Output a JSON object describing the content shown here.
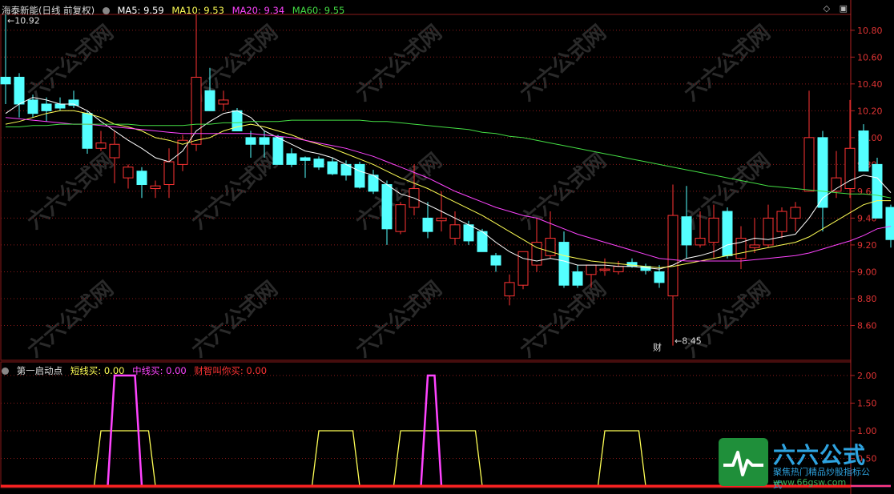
{
  "header": {
    "stock_title": "海泰新能(日线 前复权)",
    "ma5": "MA5: 9.59",
    "ma10": "MA10: 9.53",
    "ma20": "MA20: 9.34",
    "ma60": "MA60: 9.55",
    "colors": {
      "ma5": "#ffffff",
      "ma10": "#ffff55",
      "ma20": "#ff44ff",
      "ma60": "#44dd44"
    }
  },
  "indicator": {
    "title": "第一启动点",
    "short": "短线买: 0.00",
    "mid": "中线买: 0.00",
    "wisdom": "财智叫你买: 0.00",
    "colors": {
      "short": "#ffff55",
      "mid": "#ff44ff",
      "wisdom": "#ff3333"
    }
  },
  "annotations": {
    "high": "10.92",
    "low": "8.45",
    "marker": "财"
  },
  "watermark": "六六公式网",
  "logo": {
    "title": "六六公式",
    "subtitle": "聚焦热门精品炒股指标公式",
    "url": "www.66gsw.com"
  },
  "chart_data": [
    {
      "type": "candlestick",
      "title": "海泰新能(日线 前复权)",
      "y_ticks": [
        8.6,
        8.8,
        9.0,
        9.2,
        9.4,
        9.6,
        9.8,
        10.0,
        10.2,
        10.4,
        10.6,
        10.8
      ],
      "ylim": [
        8.4,
        10.93
      ],
      "up_color": "#ff3333",
      "down_color": "#54ffff",
      "candles": [
        {
          "o": 10.45,
          "h": 10.92,
          "l": 10.25,
          "c": 10.4
        },
        {
          "o": 10.45,
          "h": 10.48,
          "l": 10.15,
          "c": 10.25
        },
        {
          "o": 10.28,
          "h": 10.32,
          "l": 10.15,
          "c": 10.18
        },
        {
          "o": 10.25,
          "h": 10.3,
          "l": 10.12,
          "c": 10.2
        },
        {
          "o": 10.25,
          "h": 10.3,
          "l": 10.2,
          "c": 10.22
        },
        {
          "o": 10.28,
          "h": 10.35,
          "l": 10.22,
          "c": 10.24
        },
        {
          "o": 10.18,
          "h": 10.2,
          "l": 9.88,
          "c": 9.92
        },
        {
          "o": 9.92,
          "h": 10.05,
          "l": 9.9,
          "c": 9.96
        },
        {
          "o": 9.85,
          "h": 10.05,
          "l": 9.66,
          "c": 9.95
        },
        {
          "o": 9.7,
          "h": 9.8,
          "l": 9.62,
          "c": 9.78
        },
        {
          "o": 9.75,
          "h": 9.78,
          "l": 9.55,
          "c": 9.65
        },
        {
          "o": 9.62,
          "h": 9.68,
          "l": 9.55,
          "c": 9.64
        },
        {
          "o": 9.65,
          "h": 9.92,
          "l": 9.55,
          "c": 9.82
        },
        {
          "o": 9.8,
          "h": 10.02,
          "l": 9.75,
          "c": 9.98
        },
        {
          "o": 9.95,
          "h": 10.92,
          "l": 9.9,
          "c": 10.45
        },
        {
          "o": 10.35,
          "h": 10.52,
          "l": 10.2,
          "c": 10.2
        },
        {
          "o": 10.25,
          "h": 10.35,
          "l": 10.2,
          "c": 10.28
        },
        {
          "o": 10.2,
          "h": 10.22,
          "l": 10.08,
          "c": 10.05
        },
        {
          "o": 10.0,
          "h": 10.05,
          "l": 9.85,
          "c": 9.95
        },
        {
          "o": 10.0,
          "h": 10.05,
          "l": 9.85,
          "c": 9.95
        },
        {
          "o": 10.0,
          "h": 10.02,
          "l": 9.8,
          "c": 9.8
        },
        {
          "o": 9.88,
          "h": 9.92,
          "l": 9.78,
          "c": 9.8
        },
        {
          "o": 9.85,
          "h": 9.86,
          "l": 9.7,
          "c": 9.83
        },
        {
          "o": 9.84,
          "h": 9.86,
          "l": 9.76,
          "c": 9.78
        },
        {
          "o": 9.82,
          "h": 9.85,
          "l": 9.72,
          "c": 9.73
        },
        {
          "o": 9.8,
          "h": 9.83,
          "l": 9.68,
          "c": 9.72
        },
        {
          "o": 9.8,
          "h": 9.82,
          "l": 9.62,
          "c": 9.63
        },
        {
          "o": 9.72,
          "h": 9.76,
          "l": 9.58,
          "c": 9.6
        },
        {
          "o": 9.65,
          "h": 9.68,
          "l": 9.2,
          "c": 9.32
        },
        {
          "o": 9.3,
          "h": 9.52,
          "l": 9.28,
          "c": 9.5
        },
        {
          "o": 9.48,
          "h": 9.8,
          "l": 9.42,
          "c": 9.62
        },
        {
          "o": 9.4,
          "h": 9.52,
          "l": 9.25,
          "c": 9.3
        },
        {
          "o": 9.38,
          "h": 9.6,
          "l": 9.3,
          "c": 9.4
        },
        {
          "o": 9.25,
          "h": 9.45,
          "l": 9.2,
          "c": 9.35
        },
        {
          "o": 9.35,
          "h": 9.38,
          "l": 9.2,
          "c": 9.23
        },
        {
          "o": 9.3,
          "h": 9.32,
          "l": 9.15,
          "c": 9.15
        },
        {
          "o": 9.12,
          "h": 9.14,
          "l": 9.0,
          "c": 9.05
        },
        {
          "o": 8.82,
          "h": 8.98,
          "l": 8.75,
          "c": 8.92
        },
        {
          "o": 8.9,
          "h": 9.1,
          "l": 8.87,
          "c": 9.15
        },
        {
          "o": 9.05,
          "h": 9.4,
          "l": 9.0,
          "c": 9.22
        },
        {
          "o": 9.12,
          "h": 9.45,
          "l": 9.1,
          "c": 9.25
        },
        {
          "o": 9.22,
          "h": 9.3,
          "l": 8.88,
          "c": 8.9
        },
        {
          "o": 9.0,
          "h": 9.05,
          "l": 8.88,
          "c": 8.9
        },
        {
          "o": 8.98,
          "h": 9.05,
          "l": 8.88,
          "c": 9.05
        },
        {
          "o": 9.02,
          "h": 9.1,
          "l": 8.97,
          "c": 9.02
        },
        {
          "o": 9.0,
          "h": 9.08,
          "l": 8.98,
          "c": 9.04
        },
        {
          "o": 9.07,
          "h": 9.1,
          "l": 9.03,
          "c": 9.04
        },
        {
          "o": 9.04,
          "h": 9.06,
          "l": 8.98,
          "c": 9.01
        },
        {
          "o": 9.0,
          "h": 9.05,
          "l": 8.88,
          "c": 8.92
        },
        {
          "o": 8.82,
          "h": 9.65,
          "l": 8.45,
          "c": 9.42
        },
        {
          "o": 9.41,
          "h": 9.64,
          "l": 9.1,
          "c": 9.2
        },
        {
          "o": 9.2,
          "h": 9.45,
          "l": 9.18,
          "c": 9.25
        },
        {
          "o": 9.22,
          "h": 9.5,
          "l": 9.1,
          "c": 9.4
        },
        {
          "o": 9.45,
          "h": 9.48,
          "l": 9.1,
          "c": 9.12
        },
        {
          "o": 9.1,
          "h": 9.34,
          "l": 9.02,
          "c": 9.25
        },
        {
          "o": 9.18,
          "h": 9.4,
          "l": 9.14,
          "c": 9.2
        },
        {
          "o": 9.2,
          "h": 9.5,
          "l": 9.18,
          "c": 9.4
        },
        {
          "o": 9.3,
          "h": 9.48,
          "l": 9.25,
          "c": 9.45
        },
        {
          "o": 9.4,
          "h": 9.52,
          "l": 9.3,
          "c": 9.48
        },
        {
          "o": 9.6,
          "h": 10.35,
          "l": 9.6,
          "c": 10.0
        },
        {
          "o": 10.0,
          "h": 10.05,
          "l": 9.3,
          "c": 9.48
        },
        {
          "o": 9.6,
          "h": 9.9,
          "l": 9.55,
          "c": 9.7
        },
        {
          "o": 9.62,
          "h": 10.28,
          "l": 9.55,
          "c": 9.92
        },
        {
          "o": 10.05,
          "h": 10.1,
          "l": 9.75,
          "c": 9.75
        },
        {
          "o": 9.8,
          "h": 9.85,
          "l": 9.4,
          "c": 9.4
        },
        {
          "o": 9.48,
          "h": 9.5,
          "l": 9.18,
          "c": 9.24
        }
      ],
      "ma_series": [
        {
          "name": "MA5",
          "color": "#ffffff",
          "values": [
            10.18,
            10.25,
            10.3,
            10.28,
            10.25,
            10.25,
            10.2,
            10.12,
            10.05,
            9.98,
            9.92,
            9.85,
            9.82,
            9.9,
            10.05,
            10.12,
            10.18,
            10.2,
            10.15,
            10.05,
            10.0,
            9.95,
            9.9,
            9.88,
            9.85,
            9.8,
            9.75,
            9.72,
            9.65,
            9.58,
            9.55,
            9.5,
            9.45,
            9.4,
            9.35,
            9.3,
            9.22,
            9.15,
            9.1,
            9.08,
            9.1,
            9.08,
            9.05,
            9.05,
            9.05,
            9.04,
            9.04,
            9.03,
            9.02,
            9.05,
            9.1,
            9.12,
            9.15,
            9.2,
            9.22,
            9.25,
            9.24,
            9.26,
            9.28,
            9.4,
            9.55,
            9.62,
            9.68,
            9.72,
            9.7,
            9.59
          ]
        },
        {
          "name": "MA10",
          "color": "#ffff55",
          "values": [
            10.1,
            10.12,
            10.15,
            10.18,
            10.2,
            10.2,
            10.18,
            10.15,
            10.1,
            10.08,
            10.05,
            10.0,
            9.98,
            9.95,
            9.98,
            10.0,
            10.05,
            10.08,
            10.1,
            10.08,
            10.05,
            10.02,
            9.98,
            9.95,
            9.92,
            9.88,
            9.84,
            9.8,
            9.75,
            9.7,
            9.66,
            9.62,
            9.57,
            9.52,
            9.47,
            9.42,
            9.36,
            9.3,
            9.24,
            9.18,
            9.15,
            9.12,
            9.1,
            9.08,
            9.07,
            9.06,
            9.05,
            9.04,
            9.03,
            9.04,
            9.06,
            9.08,
            9.1,
            9.12,
            9.14,
            9.16,
            9.18,
            9.2,
            9.22,
            9.26,
            9.32,
            9.38,
            9.44,
            9.5,
            9.53,
            9.53
          ]
        },
        {
          "name": "MA20",
          "color": "#ff44ff",
          "values": [
            10.15,
            10.14,
            10.13,
            10.12,
            10.11,
            10.1,
            10.1,
            10.09,
            10.08,
            10.07,
            10.06,
            10.05,
            10.04,
            10.03,
            10.03,
            10.03,
            10.03,
            10.03,
            10.03,
            10.02,
            10.01,
            10.0,
            9.98,
            9.96,
            9.94,
            9.92,
            9.89,
            9.86,
            9.82,
            9.78,
            9.74,
            9.7,
            9.65,
            9.6,
            9.56,
            9.52,
            9.48,
            9.45,
            9.42,
            9.4,
            9.36,
            9.32,
            9.28,
            9.25,
            9.22,
            9.19,
            9.16,
            9.13,
            9.1,
            9.09,
            9.08,
            9.08,
            9.08,
            9.08,
            9.08,
            9.09,
            9.1,
            9.11,
            9.12,
            9.14,
            9.17,
            9.2,
            9.23,
            9.27,
            9.32,
            9.34
          ]
        },
        {
          "name": "MA60",
          "color": "#44dd44",
          "values": [
            10.08,
            10.08,
            10.09,
            10.09,
            10.1,
            10.1,
            10.1,
            10.1,
            10.1,
            10.1,
            10.09,
            10.09,
            10.09,
            10.09,
            10.1,
            10.1,
            10.11,
            10.11,
            10.12,
            10.12,
            10.12,
            10.13,
            10.13,
            10.13,
            10.13,
            10.13,
            10.13,
            10.12,
            10.12,
            10.11,
            10.1,
            10.09,
            10.08,
            10.07,
            10.06,
            10.04,
            10.03,
            10.01,
            10.0,
            9.98,
            9.96,
            9.94,
            9.92,
            9.9,
            9.88,
            9.86,
            9.84,
            9.82,
            9.8,
            9.78,
            9.76,
            9.74,
            9.72,
            9.7,
            9.68,
            9.66,
            9.64,
            9.63,
            9.62,
            9.61,
            9.6,
            9.59,
            9.58,
            9.58,
            9.57,
            9.55
          ]
        }
      ]
    },
    {
      "type": "line",
      "title": "第一启动点",
      "y_ticks": [
        0.5,
        1.0,
        1.5,
        2.0
      ],
      "ylim": [
        -0.02,
        2.1
      ],
      "series": [
        {
          "name": "短线买",
          "color": "#ffff55",
          "values": [
            0,
            0,
            0,
            0,
            0,
            0,
            0,
            1,
            1,
            1,
            1,
            0,
            0,
            0,
            0,
            0,
            0,
            0,
            0,
            0,
            0,
            0,
            0,
            1,
            1,
            1,
            0,
            0,
            0,
            1,
            1,
            1,
            1,
            1,
            1,
            0,
            0,
            0,
            0,
            0,
            0,
            0,
            0,
            0,
            1,
            1,
            1,
            0,
            0,
            0,
            0,
            0,
            0,
            0,
            0,
            0,
            0,
            0,
            0,
            0,
            0,
            0,
            0,
            0,
            0,
            0
          ]
        },
        {
          "name": "中线买",
          "color": "#ff44ff",
          "values": [
            0,
            0,
            0,
            0,
            0,
            0,
            0,
            0,
            2,
            2,
            0,
            0,
            0,
            0,
            0,
            0,
            0,
            0,
            0,
            0,
            0,
            0,
            0,
            0,
            0,
            0,
            0,
            0,
            0,
            0,
            0,
            2,
            0,
            0,
            0,
            0,
            0,
            0,
            0,
            0,
            0,
            0,
            0,
            0,
            0,
            0,
            0,
            0,
            0,
            0,
            0,
            0,
            0,
            0,
            0,
            0,
            0,
            0,
            0,
            0,
            0,
            0,
            0,
            0,
            0,
            0
          ]
        },
        {
          "name": "财智叫你买",
          "color": "#ff3333",
          "values": [
            0,
            0,
            0,
            0,
            0,
            0,
            0,
            0,
            0,
            0,
            0,
            0,
            0,
            0,
            0,
            0,
            0,
            0,
            0,
            0,
            0,
            0,
            0,
            0,
            0,
            0,
            0,
            0,
            0,
            0,
            0,
            0,
            0,
            0,
            0,
            0,
            0,
            0,
            0,
            0,
            0,
            0,
            0,
            0,
            0,
            0,
            0,
            0,
            0,
            0,
            0,
            0,
            0,
            0,
            0,
            0,
            0,
            0,
            0,
            0,
            0,
            0,
            0,
            0,
            0,
            0
          ]
        }
      ]
    }
  ]
}
